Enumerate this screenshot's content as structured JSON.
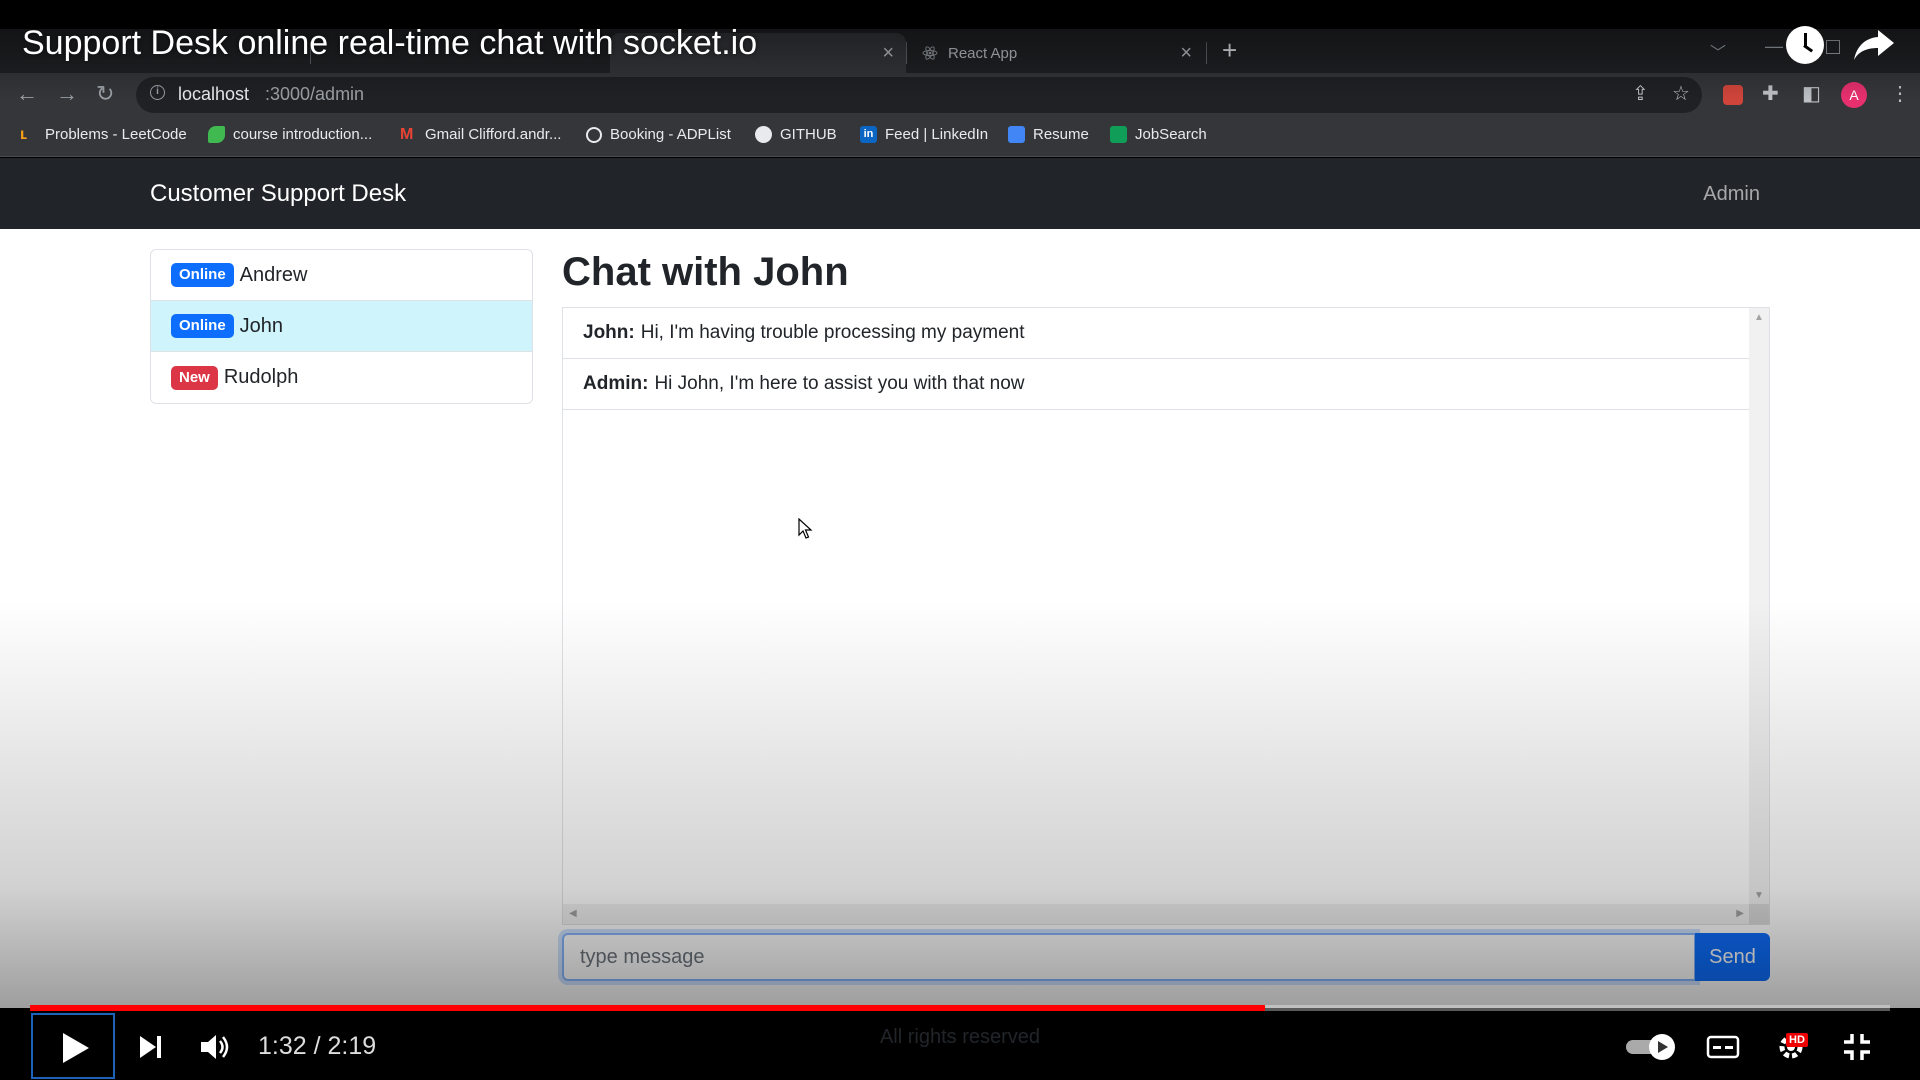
{
  "video": {
    "title": "Support Desk online real-time chat with socket.io",
    "time_current": "1:32",
    "time_total": "2:19",
    "time_display": "1:32 / 2:19",
    "progress_fraction": 0.664,
    "footer_text": "All rights reserved"
  },
  "browser": {
    "tabs": [
      {
        "label": "",
        "active": false
      },
      {
        "label": "",
        "active": false
      },
      {
        "label": "",
        "active": true
      },
      {
        "label": "React App",
        "active": false
      }
    ],
    "url_host": "localhost",
    "url_path": ":3000/admin",
    "profile_initial": "A",
    "bookmarks": [
      {
        "label": "Problems - LeetCode",
        "icon": "leetcode-icon",
        "color": "#f89f1b"
      },
      {
        "label": "course introduction...",
        "icon": "leaf-icon",
        "color": "#3fb950"
      },
      {
        "label": "Gmail Clifford.andr...",
        "icon": "gmail-icon",
        "color": "#ea4335"
      },
      {
        "label": "Booking - ADPList",
        "icon": "adplist-icon",
        "color": "#e8eaed"
      },
      {
        "label": "GITHUB",
        "icon": "github-icon",
        "color": "#e8eaed"
      },
      {
        "label": "Feed | LinkedIn",
        "icon": "linkedin-icon",
        "color": "#0a66c2"
      },
      {
        "label": "Resume",
        "icon": "docs-icon",
        "color": "#4285f4"
      },
      {
        "label": "JobSearch",
        "icon": "sheets-icon",
        "color": "#0f9d58"
      }
    ]
  },
  "navbar": {
    "brand": "Customer Support Desk",
    "admin": "Admin"
  },
  "users": [
    {
      "badge": "Online",
      "badge_type": "online",
      "name": "Andrew",
      "active": false
    },
    {
      "badge": "Online",
      "badge_type": "online",
      "name": "John",
      "active": true
    },
    {
      "badge": "New",
      "badge_type": "new",
      "name": "Rudolph",
      "active": false
    }
  ],
  "chat": {
    "title": "Chat with John",
    "messages": [
      {
        "sender": "John:",
        "text": "Hi, I'm having trouble processing my payment"
      },
      {
        "sender": "Admin:",
        "text": "Hi John, I'm here to assist you with that now"
      }
    ],
    "input_placeholder": "type message",
    "send_label": "Send"
  },
  "colors": {
    "primary": "#0d6efd",
    "danger": "#dc3545",
    "navbar": "#212529",
    "active_item": "#cff4fc",
    "progress": "#ff0000"
  }
}
